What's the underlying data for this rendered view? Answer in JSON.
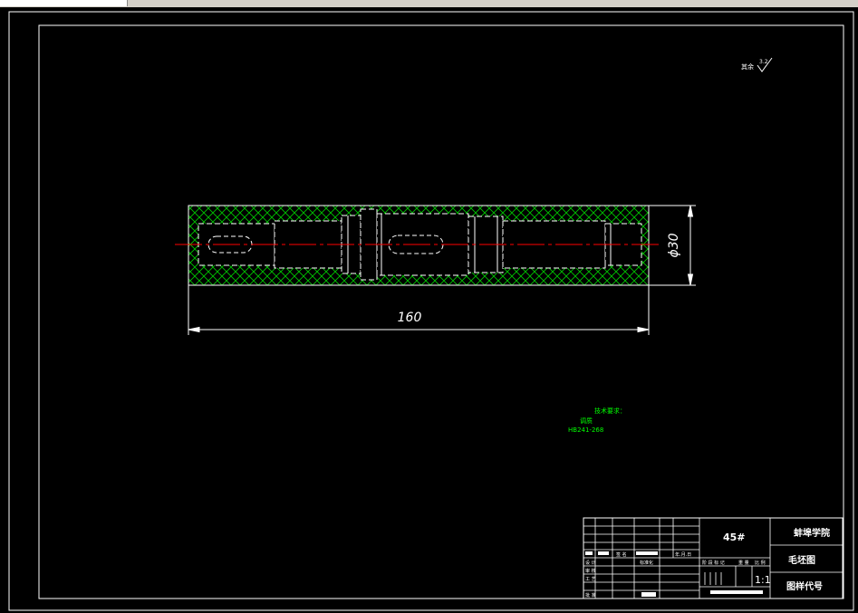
{
  "drawing": {
    "dimension_length": "160",
    "dimension_diameter": "ϕ30",
    "surface_note_label": "其余",
    "surface_note_value": "3.2",
    "tech_requirements": {
      "heading": "技术要求：",
      "line1": "调质",
      "line2": "HB241-268"
    }
  },
  "title_block": {
    "material": "45#",
    "school": "蚌埠学院",
    "drawing_name": "毛坯图",
    "drawing_code_label": "图样代号",
    "scale": "1:1",
    "row_design": "设 计",
    "row_check": "审 核",
    "row_process": "工 艺",
    "row_approve": "批 准",
    "standardize": "标准化",
    "stage_header": "阶 段 标 记",
    "weight_header": "重 量",
    "scale_header": "比 例",
    "sign": "签 名",
    "date": "年.月.日"
  },
  "colors": {
    "background": "#000000",
    "line": "#ffffff",
    "hatch": "#00c400",
    "centerline": "#ff0000",
    "annotation": "#00ff00"
  }
}
